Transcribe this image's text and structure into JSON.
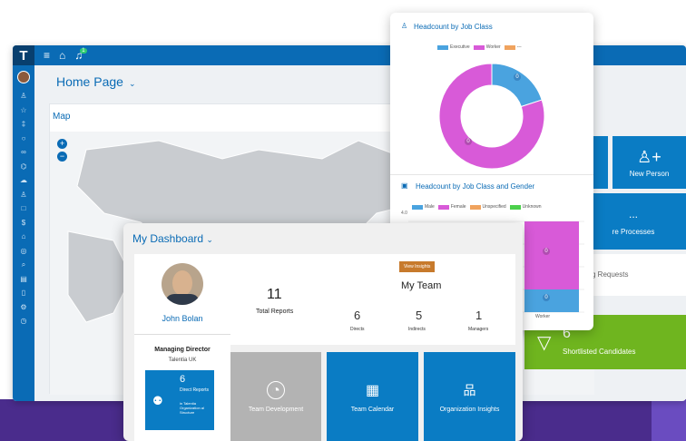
{
  "app": {
    "logo": "T",
    "notification_count": "1",
    "page_title": "Home Page"
  },
  "map": {
    "title": "Map",
    "zoom_in": "+",
    "zoom_out": "−"
  },
  "right_tiles": {
    "section_label": "n",
    "new_person": "New Person",
    "processes_dots": "...",
    "processes": "re Processes",
    "requests": "g Requests",
    "shortlist_count": "6",
    "shortlist": "Shortlisted Candidates"
  },
  "headcount": {
    "title": "Headcount by Job Class",
    "legend": [
      {
        "label": "Executive",
        "color": "#4aa3df"
      },
      {
        "label": "Worker",
        "color": "#d85ad8"
      },
      {
        "label": "---",
        "color": "#f0a35e"
      }
    ],
    "donut_labels": [
      "0",
      "0"
    ],
    "gender_title": "Headcount by Job Class and Gender",
    "gender_legend": [
      {
        "label": "Male",
        "color": "#4aa3df"
      },
      {
        "label": "Female",
        "color": "#d85ad8"
      },
      {
        "label": "Unspecified",
        "color": "#f0a35e"
      },
      {
        "label": "Unknown",
        "color": "#4cd04c"
      }
    ],
    "y_max_label": "4.0",
    "bar_labels": [
      "0",
      "0"
    ],
    "x_category": "Worker"
  },
  "chart_data": [
    {
      "type": "pie",
      "title": "Headcount by Job Class",
      "categories": [
        "Executive",
        "Worker",
        "---"
      ],
      "values": [
        1,
        4,
        0
      ]
    },
    {
      "type": "bar",
      "title": "Headcount by Job Class and Gender",
      "categories": [
        "Worker"
      ],
      "series": [
        {
          "name": "Male",
          "values": [
            1
          ]
        },
        {
          "name": "Female",
          "values": [
            3
          ]
        },
        {
          "name": "Unspecified",
          "values": [
            0
          ]
        },
        {
          "name": "Unknown",
          "values": [
            0
          ]
        }
      ],
      "ylim": [
        0,
        4
      ]
    }
  ],
  "dashboard": {
    "title": "My Dashboard",
    "profile": {
      "name": "John Bolan",
      "role": "Managing Director",
      "org": "Talentia UK",
      "direct_count": "6",
      "direct_label": "Direct Reports",
      "direct_sub": "in Talentia Organization al Structure"
    },
    "team": {
      "view_insights": "View Insights",
      "heading": "My Team",
      "total_count": "11",
      "total_label": "Total Reports",
      "stats": [
        {
          "value": "6",
          "label": "Directs"
        },
        {
          "value": "5",
          "label": "Indirects"
        },
        {
          "value": "1",
          "label": "Managers"
        }
      ]
    },
    "tiles": [
      {
        "label": "Team Development",
        "color": "#b3b3b3"
      },
      {
        "label": "Team Calendar",
        "color": "#0a7cc4"
      },
      {
        "label": "Organization Insights",
        "color": "#0a7cc4"
      }
    ]
  }
}
